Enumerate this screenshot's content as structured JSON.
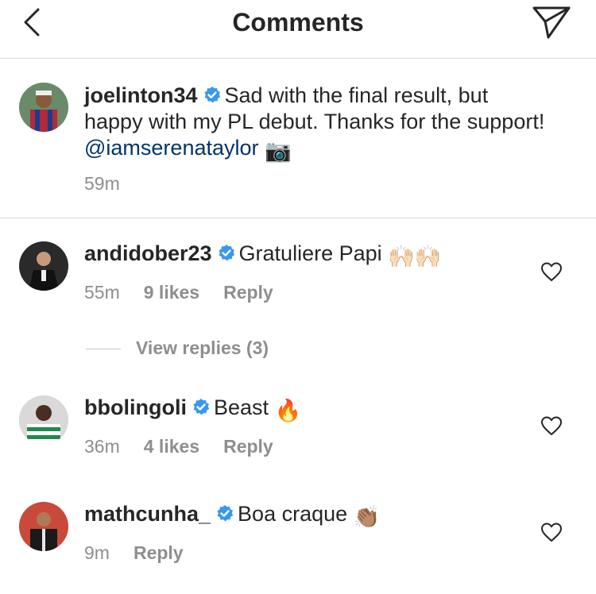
{
  "header": {
    "title": "Comments"
  },
  "caption": {
    "username": "joelinton34",
    "text_before": "Sad with the final result, but happy with my PL debut. Thanks for the support!",
    "mention": "@iamserenataylor",
    "camera_emoji": "📷",
    "time": "59m"
  },
  "comments": [
    {
      "username": "andidober23",
      "text": "Gratuliere Papi",
      "emoji": "🙌🏻🙌🏻",
      "time": "55m",
      "likes": "9 likes",
      "reply": "Reply"
    },
    {
      "username": "bbolingoli",
      "text": "Beast",
      "emoji": "🔥",
      "time": "36m",
      "likes": "4 likes",
      "reply": "Reply"
    },
    {
      "username": "mathcunha_",
      "text": "Boa craque",
      "emoji": "👏🏽",
      "time": "9m",
      "reply": "Reply"
    }
  ],
  "view_replies": "View replies (3)",
  "colors": {
    "verified": "#3897f0",
    "mention": "#003569",
    "secondary_text": "#8e8e8e",
    "divider": "#dbdbdb"
  },
  "icons": {
    "back": "chevron-left-icon",
    "share": "paper-plane-icon",
    "verified": "verified-badge-icon",
    "like": "heart-outline-icon"
  }
}
